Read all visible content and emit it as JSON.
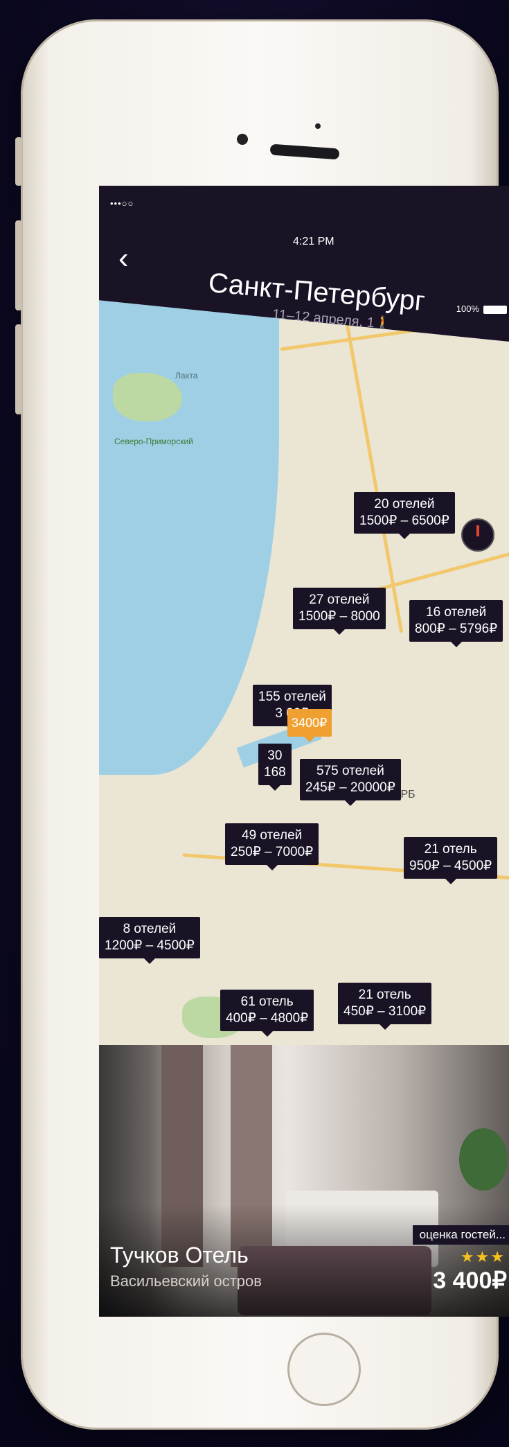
{
  "status_bar": {
    "signal": "•••○○",
    "time": "4:21 PM",
    "battery": "100%"
  },
  "nav": {
    "back_icon": "chevron-left-icon",
    "city": "Санкт-Петербург",
    "dates": "11–12 апреля, 1"
  },
  "map": {
    "labels": {
      "lakhta": "Лахта",
      "north_park": "Северо-Приморский",
      "spb": "САНКТ-ПЕТЕРБ"
    },
    "pins": [
      {
        "count": "20 отелей",
        "range": "1500₽ – 6500₽"
      },
      {
        "count": "27 отелей",
        "range": "1500₽ – 8000"
      },
      {
        "count": "16 отелей",
        "range": "800₽ – 5796₽"
      },
      {
        "count": "155 отелей",
        "range": "3   00₽"
      },
      {
        "count": "30",
        "range": "168"
      },
      {
        "count": "575 отелей",
        "range": "245₽ – 20000₽"
      },
      {
        "count": "49 отелей",
        "range": "250₽ – 7000₽"
      },
      {
        "count": "21 отель",
        "range": "950₽ – 4500₽"
      },
      {
        "count": "8 отелей",
        "range": "1200₽ – 4500₽"
      },
      {
        "count": "61 отель",
        "range": "400₽ – 4800₽"
      },
      {
        "count": "21 отель",
        "range": "450₽ – 3100₽"
      }
    ],
    "active_pin": "3400₽",
    "colors": {
      "water": "#9fcfe4",
      "roads": "#f2c86c",
      "pin_bg": "#1a1326",
      "active": "#f0a030"
    }
  },
  "hotel_card": {
    "name": "Тучков Отель",
    "district": "Васильевский остров",
    "rating_label": "оценка гостей...",
    "stars": "★★★",
    "price": "3 400₽"
  }
}
